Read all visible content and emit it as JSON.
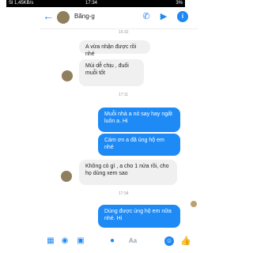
{
  "status": {
    "left": "Sl 1,45KB/s",
    "time": "17:34",
    "battery": "3%"
  },
  "header": {
    "name": "Bãng-g"
  },
  "messages": {
    "t1": "15:32",
    "m1": "A vừa nhận được rồi nhé",
    "m2": "Mùi dễ chịu , đuổi muỗi tốt",
    "t2": "17:11",
    "m3": "Muỗi nhà a nó say hay ngất luôn a. Hi",
    "m4": "Cám ơn a đã ủng hộ em nhé",
    "m5": "Không có gì , a cho 1 nửa rồi, cho họ dùng xem sao",
    "t3": "17:34",
    "m6": "Dùng được ủng hộ em nữa nhé. Hi"
  },
  "footer": {
    "aa": "Aa"
  },
  "colors": {
    "accent": "#1e88f5",
    "incoming": "#f0f0f0",
    "outgoing": "#1e8af6"
  },
  "icons": {
    "back": "back-arrow-icon",
    "phone": "phone-icon",
    "video": "video-icon",
    "info": "info-icon",
    "menu": "menu-icon",
    "camera": "camera-icon",
    "image": "image-icon",
    "mic": "mic-icon",
    "emoji": "emoji-icon",
    "like": "thumbs-up-icon"
  }
}
